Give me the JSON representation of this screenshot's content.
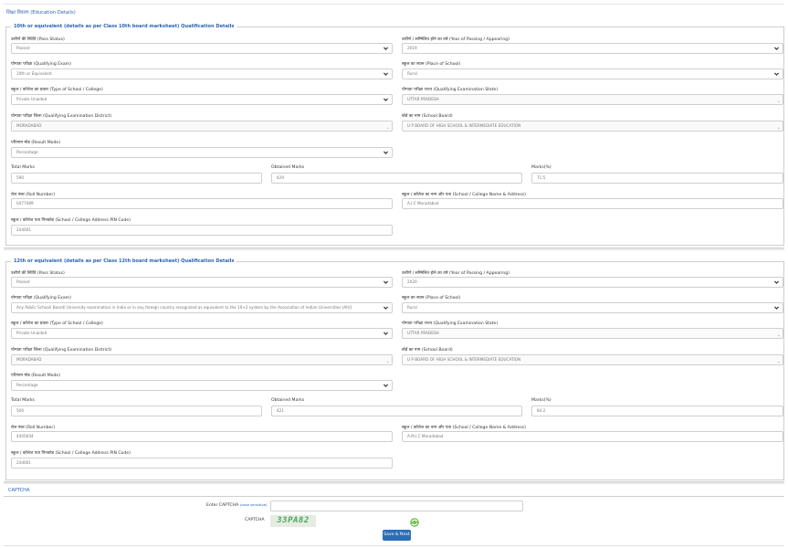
{
  "page": {
    "section_title": "शिक्षा विवरण (Education Details)"
  },
  "tenth": {
    "legend": "10th or equivalent (details as per Class 10th board marksheet) Qualification Details",
    "pass_status": {
      "label": "उत्तीर्ण की स्थिति (Pass Status)",
      "value": "Passed"
    },
    "year": {
      "label": "उत्तीर्ण / सम्मिलित होने का वर्ष (Year of Passing / Appearing)",
      "value": "2019"
    },
    "exam": {
      "label": "योग्यता परीक्षा (Qualifying Exam)",
      "value": "10th or Equivalent"
    },
    "place": {
      "label": "स्कूल का स्थान (Place of School)",
      "value": "Rural"
    },
    "type": {
      "label": "स्कूल / कॉलेज का प्रकार (Type of School / College)",
      "value": "Private Unaided"
    },
    "state": {
      "label": "योग्यता परीक्षा राज्य (Qualifying Examination State)",
      "value": "UTTAR PRADESH"
    },
    "district": {
      "label": "योग्यता परीक्षा जिला (Qualifying Examination District)",
      "value": "MORADABAD"
    },
    "board": {
      "label": "बोर्ड का नाम (School Board)",
      "value": "U P BOARD OF HIGH SCHOOL & INTERMEDIATE EDUCATION"
    },
    "result_mode": {
      "label": "परिणाम मोड (Result Mode)",
      "value": "Percentage"
    },
    "total": {
      "label": "Total Marks",
      "value": "590"
    },
    "obtained": {
      "label": "Obtained Marks",
      "value": "429"
    },
    "percent": {
      "label": "Marks(%)",
      "value": "71.5"
    },
    "roll": {
      "label": "रोल नंबर (Roll Number)",
      "value": "0477489"
    },
    "school_name": {
      "label": "स्कूल / कॉलेज का नाम और पता (School / College Name & Address)",
      "value": "A.I.C Moradabad"
    },
    "pin": {
      "label": "स्कूल / कॉलेज पता पिनकोड (School / College Address PIN Code)",
      "value": "244001"
    }
  },
  "twelfth": {
    "legend": "12th or equivalent (details as per Class 12th board marksheet) Qualification Details",
    "pass_status": {
      "label": "उत्तीर्ण की स्थिति (Pass Status)",
      "value": "Passed"
    },
    "year": {
      "label": "उत्तीर्ण / सम्मिलित होने का वर्ष (Year of Passing / Appearing)",
      "value": "2020"
    },
    "exam": {
      "label": "योग्यता परीक्षा (Qualifying Exam)",
      "value": "Any Public School/ Board/ University examination in India or in any foreign country recognized as equivalent to the 10+2 system by the Association of Indian Universities (AIU)."
    },
    "place": {
      "label": "स्कूल का स्थान (Place of School)",
      "value": "Rural"
    },
    "type": {
      "label": "स्कूल / कॉलेज का प्रकार (Type of School / College)",
      "value": "Private Unaided"
    },
    "state": {
      "label": "योग्यता परीक्षा राज्य (Qualifying Examination State)",
      "value": "UTTAR PRADESH"
    },
    "district": {
      "label": "योग्यता परीक्षा जिला (Qualifying Examination District)",
      "value": "MORADABAD"
    },
    "board": {
      "label": "बोर्ड का नाम (School Board)",
      "value": "U P BOARD OF HIGH SCHOOL & INTERMEDIATE EDUCATION"
    },
    "result_mode": {
      "label": "परिणाम मोड (Result Mode)",
      "value": "Percentage"
    },
    "total": {
      "label": "Total Marks",
      "value": "500"
    },
    "obtained": {
      "label": "Obtained Marks",
      "value": "421"
    },
    "percent": {
      "label": "Marks(%)",
      "value": "84.2"
    },
    "roll": {
      "label": "रोल नंबर (Roll Number)",
      "value": "4405644"
    },
    "school_name": {
      "label": "स्कूल / कॉलेज का नाम और पता (School / College Name & Address)",
      "value": "A.M.I.C Moradabad"
    },
    "pin": {
      "label": "स्कूल / कॉलेज पता पिनकोड (School / College Address PIN Code)",
      "value": "244001"
    }
  },
  "captcha": {
    "title": "CAPTCHA",
    "enter_label": "Enter CAPTCHA",
    "case_hint": "(case sensitive)",
    "image_label": "CAPTCHA",
    "image_text": "33PA82",
    "input_value": "",
    "submit_label": "Save & Next"
  },
  "icons": {
    "dropdown": "chevron-down-icon",
    "refresh": "refresh-icon"
  },
  "colors": {
    "accent": "#2a64b4",
    "button": "#2c6fb7",
    "captcha_text": "#4aa864"
  }
}
